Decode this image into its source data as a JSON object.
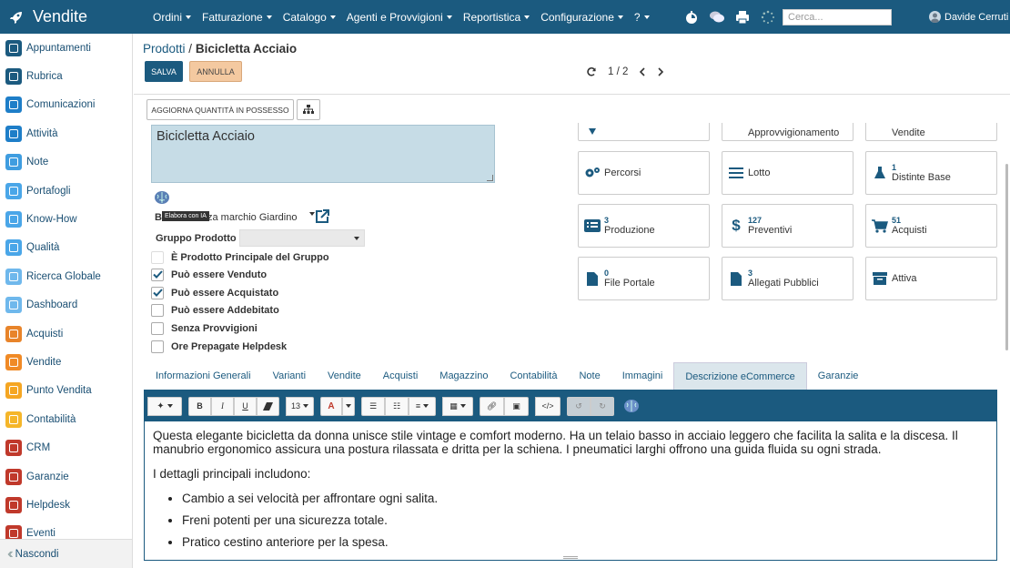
{
  "app": {
    "title": "Vendite"
  },
  "nav": {
    "menus": [
      {
        "label": "Ordini"
      },
      {
        "label": "Fatturazione"
      },
      {
        "label": "Catalogo"
      },
      {
        "label": "Agenti e Provvigioni"
      },
      {
        "label": "Reportistica"
      },
      {
        "label": "Configurazione"
      },
      {
        "label": "?"
      }
    ],
    "search_placeholder": "Cerca...",
    "user_name": "Davide Cerruti"
  },
  "sidebar": {
    "items": [
      {
        "label": "Appuntamenti",
        "icon": "calendar-icon",
        "color": "#1b5a7f"
      },
      {
        "label": "Rubrica",
        "icon": "contacts-icon",
        "color": "#1b5a7f"
      },
      {
        "label": "Comunicazioni",
        "icon": "chat-icon",
        "color": "#1e7ec8"
      },
      {
        "label": "Attività",
        "icon": "check-icon",
        "color": "#1e7ec8"
      },
      {
        "label": "Note",
        "icon": "note-icon",
        "color": "#3f9de0"
      },
      {
        "label": "Portafogli",
        "icon": "briefcase-icon",
        "color": "#4aa6e8"
      },
      {
        "label": "Know-How",
        "icon": "bulb-icon",
        "color": "#4aa6e8"
      },
      {
        "label": "Qualità",
        "icon": "quality-icon",
        "color": "#4aa6e8"
      },
      {
        "label": "Ricerca Globale",
        "icon": "search-icon",
        "color": "#6fb8ec"
      },
      {
        "label": "Dashboard",
        "icon": "dashboard-icon",
        "color": "#6fb8ec"
      },
      {
        "label": "Acquisti",
        "icon": "purchase-icon",
        "color": "#e8842a"
      },
      {
        "label": "Vendite",
        "icon": "sales-icon",
        "color": "#f08a26"
      },
      {
        "label": "Punto Vendita",
        "icon": "pos-icon",
        "color": "#f5a623"
      },
      {
        "label": "Contabilità",
        "icon": "accounting-icon",
        "color": "#f5b62a"
      },
      {
        "label": "CRM",
        "icon": "crm-icon",
        "color": "#c0392b"
      },
      {
        "label": "Garanzie",
        "icon": "shield-icon",
        "color": "#c0392b"
      },
      {
        "label": "Helpdesk",
        "icon": "headset-icon",
        "color": "#c0392b"
      },
      {
        "label": "Eventi",
        "icon": "event-icon",
        "color": "#c0392b"
      }
    ],
    "footer_label": "Nascondi"
  },
  "breadcrumb": {
    "parent": "Prodotti",
    "separator": "/",
    "current": "Bicicletta Acciaio"
  },
  "actions": {
    "save": "SALVA",
    "cancel": "ANNULLA",
    "update_qty": "AGGIORNA QUANTITÀ IN POSSESSO"
  },
  "pager": {
    "text": "1 / 2"
  },
  "form": {
    "product_name": "Bicicletta Acciaio",
    "ai_tooltip": "Elabora con IA",
    "brand_label": "Br",
    "brand_value": "za marchio Giardino",
    "group_label": "Gruppo Prodotto",
    "checkboxes": [
      {
        "label": "È Prodotto Principale del Gruppo",
        "checked": false
      },
      {
        "label": "Può essere Venduto",
        "checked": true
      },
      {
        "label": "Può essere Acquistato",
        "checked": true
      },
      {
        "label": "Può essere Addebitato",
        "checked": false
      },
      {
        "label": "Senza Provvigioni",
        "checked": false
      },
      {
        "label": "Ore Prepagate Helpdesk",
        "checked": false
      }
    ]
  },
  "stats": [
    {
      "label": "",
      "count": ""
    },
    {
      "label": "Approvvigionamento",
      "count": ""
    },
    {
      "label": "Vendite",
      "count": ""
    },
    {
      "label": "Percorsi",
      "count": ""
    },
    {
      "label": "Lotto",
      "count": ""
    },
    {
      "label": "Distinte Base",
      "count": "1"
    },
    {
      "label": "Produzione",
      "count": "3"
    },
    {
      "label": "Preventivi",
      "count": "127"
    },
    {
      "label": "Acquisti",
      "count": "51"
    },
    {
      "label": "File Portale",
      "count": "0"
    },
    {
      "label": "Allegati Pubblici",
      "count": "3"
    },
    {
      "label": "Attiva",
      "count": ""
    }
  ],
  "tabs": [
    {
      "label": "Informazioni Generali"
    },
    {
      "label": "Varianti"
    },
    {
      "label": "Vendite"
    },
    {
      "label": "Acquisti"
    },
    {
      "label": "Magazzino"
    },
    {
      "label": "Contabilità"
    },
    {
      "label": "Note"
    },
    {
      "label": "Immagini"
    },
    {
      "label": "Descrizione eCommerce",
      "active": true
    },
    {
      "label": "Garanzie"
    }
  ],
  "editor": {
    "font_size": "13",
    "paragraph1": "Questa elegante bicicletta da donna unisce stile vintage e comfort moderno. Ha un telaio basso in acciaio leggero che facilita la salita e la discesa. Il manubrio ergonomico assicura una postura rilassata e dritta per la schiena. I pneumatici larghi offrono una guida fluida su ogni strada.",
    "paragraph2": "I dettagli principali includono:",
    "bullets": [
      "Cambio a sei velocità per affrontare ogni salita.",
      "Freni potenti per una sicurezza totale.",
      "Pratico cestino anteriore per la spesa."
    ]
  },
  "colors": {
    "primary": "#1b5a7f",
    "cancel": "#f4c9a0",
    "field_bg": "#c6dce6"
  }
}
